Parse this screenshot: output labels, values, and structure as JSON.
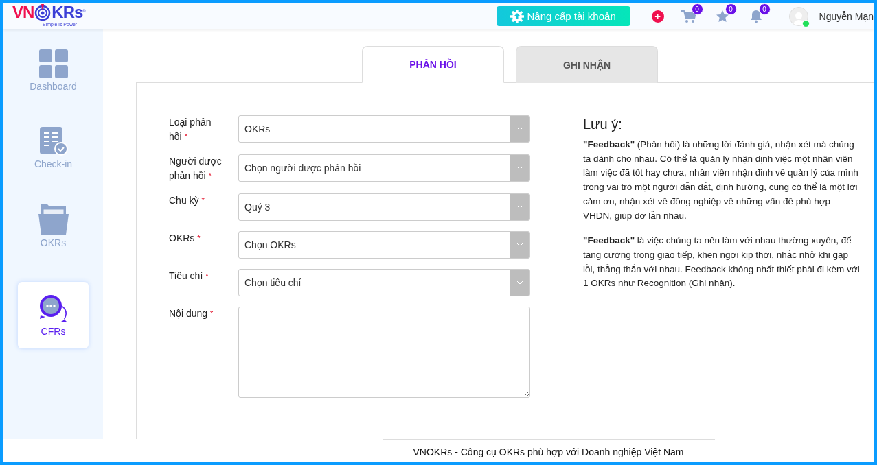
{
  "logo": {
    "letters_left": "VN",
    "letters_right": "KRs",
    "registered": "®",
    "tagline": "Simple is Power"
  },
  "header": {
    "upgrade_button": "Nâng cấp tài khoản",
    "add_button": "+",
    "badges": [
      {
        "kind": "cart",
        "count": "0"
      },
      {
        "kind": "star",
        "count": "0"
      },
      {
        "kind": "bell",
        "count": "0"
      }
    ],
    "user_name": "Nguyễn Mạn",
    "online": true
  },
  "sidebar": {
    "items": [
      {
        "kind": "dashboard",
        "label": "Dashboard",
        "selected": false
      },
      {
        "kind": "checkin",
        "label": "Check-in",
        "selected": false
      },
      {
        "kind": "okrs",
        "label": "OKRs",
        "selected": false
      },
      {
        "kind": "cfrs",
        "label": "CFRs",
        "selected": true
      }
    ]
  },
  "tabs": [
    {
      "label": "PHẢN HỒI",
      "selected": true
    },
    {
      "label": "GHI NHẬN",
      "selected": false
    }
  ],
  "form": {
    "fields": [
      {
        "kind": "select",
        "label": "Loại phản hồi",
        "mark": "*",
        "value": "OKRs"
      },
      {
        "kind": "select",
        "label": "Người được phản hồi",
        "mark": "*",
        "value": "Chọn người được phản hồi"
      },
      {
        "kind": "select",
        "label": "Chu kỳ",
        "mark": "*",
        "value": "Quý 3"
      },
      {
        "kind": "select",
        "label": "OKRs",
        "mark": "*",
        "value": "Chọn OKRs"
      },
      {
        "kind": "select",
        "label": "Tiêu chí",
        "mark": "*",
        "value": "Chọn tiêu chí"
      },
      {
        "kind": "textarea",
        "label": "Nội dung",
        "mark": "*"
      }
    ]
  },
  "note": {
    "title": "Lưu ý:",
    "paragraphs": [
      "**\"Feedback\"** (Phản hồi) là những lời đánh giá, nhận xét mà chúng ta dành cho nhau. Có thể là quản lý nhận định việc một nhân viên làm việc đã tốt hay chưa, nhân viên nhận đinh về quản lý của mình trong vai trò một người dẫn dắt, định hướng, cũng có thể là một lời cảm ơn, nhận xét về đồng nghiệp về những vấn đề phù hợp VHDN, giúp đỡ lẫn nhau.",
      "**\"Feedback\"** là việc chúng ta nên làm với nhau thường xuyên, để tăng cường trong giao tiếp, khen ngợi kịp thời, nhắc nhở khi gặp lỗi, thẳng thắn với nhau. Feedback không nhất thiết phải đi kèm với 1 OKRs như Recognition (Ghi nhận)."
    ]
  },
  "footer": "VNOKRs - Công cụ OKRs phù hợp với Doanh nghiệp Việt Nam"
}
